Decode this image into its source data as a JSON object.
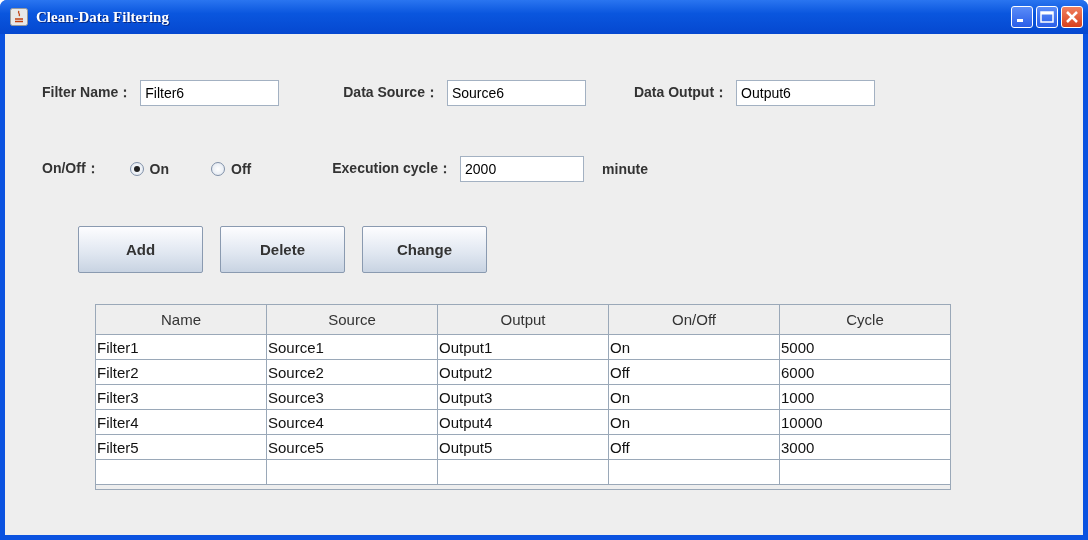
{
  "window": {
    "title": "Clean-Data Filtering"
  },
  "fields": [
    {
      "label": "Filter Name：",
      "value": "Filter6"
    },
    {
      "label": "Data Source：",
      "value": "Source6"
    },
    {
      "label": "Data Output：",
      "value": "Output6"
    }
  ],
  "on_off": {
    "label": "On/Off：",
    "options": [
      {
        "label": "On",
        "selected": true
      },
      {
        "label": "Off",
        "selected": false
      }
    ]
  },
  "execution_cycle": {
    "label": "Execution cycle：",
    "value": "2000",
    "unit": "minute"
  },
  "buttons": [
    "Add",
    "Delete",
    "Change"
  ],
  "table": {
    "columns": [
      "Name",
      "Source",
      "Output",
      "On/Off",
      "Cycle"
    ],
    "rows": [
      [
        "Filter1",
        "Source1",
        "Output1",
        "On",
        "5000"
      ],
      [
        "Filter2",
        "Source2",
        "Output2",
        "Off",
        "6000"
      ],
      [
        "Filter3",
        "Source3",
        "Output3",
        "On",
        "1000"
      ],
      [
        "Filter4",
        "Source4",
        "Output4",
        "On",
        "10000"
      ],
      [
        "Filter5",
        "Source5",
        "Output5",
        "Off",
        "3000"
      ]
    ]
  }
}
